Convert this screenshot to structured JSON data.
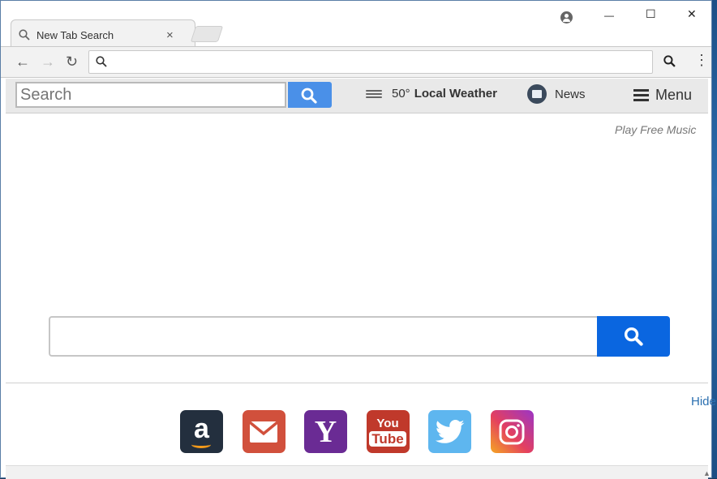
{
  "browser": {
    "tab_title": "New Tab Search",
    "tab_close": "×",
    "window_controls": {
      "minimize": "—",
      "maximize": "☐",
      "close": "✕"
    },
    "nav": {
      "back": "←",
      "forward": "→",
      "reload": "↻"
    },
    "omnibox_value": "",
    "menu_dots": "⋮"
  },
  "extension_bar": {
    "search_placeholder": "Search",
    "weather_temp": "50°",
    "weather_label": "Local Weather",
    "news_label": "News",
    "menu_label": "Menu"
  },
  "page": {
    "play_music": "Play Free Music",
    "main_search_value": "",
    "hide_label": "Hide",
    "shortcuts": [
      {
        "name": "Amazon",
        "icon": "amazon-icon",
        "glyph": "a"
      },
      {
        "name": "Gmail",
        "icon": "gmail-icon"
      },
      {
        "name": "Yahoo",
        "icon": "yahoo-icon",
        "glyph": "Y"
      },
      {
        "name": "YouTube",
        "icon": "youtube-icon",
        "line1": "You",
        "line2": "Tube"
      },
      {
        "name": "Twitter",
        "icon": "twitter-icon"
      },
      {
        "name": "Instagram",
        "icon": "instagram-icon"
      }
    ]
  },
  "colors": {
    "ext_search_button": "#4a90e8",
    "main_search_button": "#0a66e0",
    "amazon": "#232f3e",
    "gmail": "#d1503c",
    "yahoo": "#6a2b94",
    "youtube": "#c0392b",
    "twitter": "#5eb6ef"
  }
}
